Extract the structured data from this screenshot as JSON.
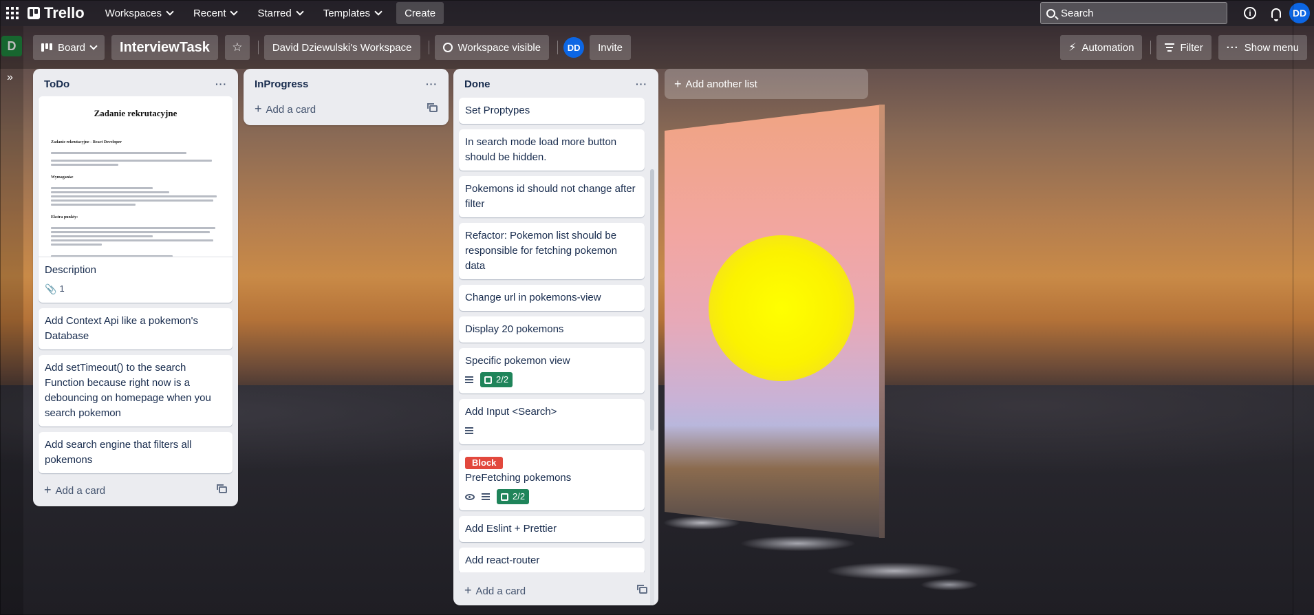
{
  "topbar": {
    "logo": "Trello",
    "nav": [
      "Workspaces",
      "Recent",
      "Starred",
      "Templates"
    ],
    "create_label": "Create",
    "search_placeholder": "Search",
    "avatar_initials": "DD"
  },
  "board": {
    "workspace_initial": "D",
    "view_label": "Board",
    "title": "InterviewTask",
    "workspace_name": "David Dziewulski's Workspace",
    "visibility_label": "Workspace visible",
    "member_initials": "DD",
    "invite_label": "Invite",
    "automation_label": "Automation",
    "filter_label": "Filter",
    "show_menu_label": "Show menu"
  },
  "cover_doc": {
    "title": "Zadanie rekrutacyjne",
    "subtitle": "Zadanie rekrutacyjne - React Developer",
    "section_requirements": "Wymagania:",
    "section_extra": "Ekstra punkty:"
  },
  "lists": [
    {
      "title": "ToDo",
      "cards": [
        {
          "title": "Description",
          "attachments": "1"
        },
        {
          "title": "Add Context Api like a pokemon's Database"
        },
        {
          "title": "Add setTimeout() to the search Function because right now is a debouncing on homepage when you search pokemon"
        },
        {
          "title": "Add search engine that filters all pokemons"
        }
      ],
      "add_card_label": "Add a card"
    },
    {
      "title": "InProgress",
      "cards": [],
      "add_card_label": "Add a card"
    },
    {
      "title": "Done",
      "cards": [
        {
          "title": "Set Proptypes"
        },
        {
          "title": "In search mode load more button should be hidden."
        },
        {
          "title": "Pokemons id should not change after filter"
        },
        {
          "title": "Refactor: Pokemon list should be responsible for fetching pokemon data"
        },
        {
          "title": "Change url in pokemons-view"
        },
        {
          "title": "Display 20 pokemons"
        },
        {
          "title": "Specific pokemon view",
          "checklist": "2/2"
        },
        {
          "title": "Add Input <Search>"
        },
        {
          "title": "PreFetching pokemons",
          "label": "Block",
          "checklist": "2/2"
        },
        {
          "title": "Add Eslint + Prettier"
        },
        {
          "title": "Add react-router"
        }
      ],
      "add_card_label": "Add a card"
    }
  ],
  "add_list_label": "Add another list",
  "colors": {
    "accent_blue": "#0c66e4",
    "workspace_green": "#1f8a40",
    "checklist_green": "#1f845a",
    "label_red": "#e2483d"
  }
}
